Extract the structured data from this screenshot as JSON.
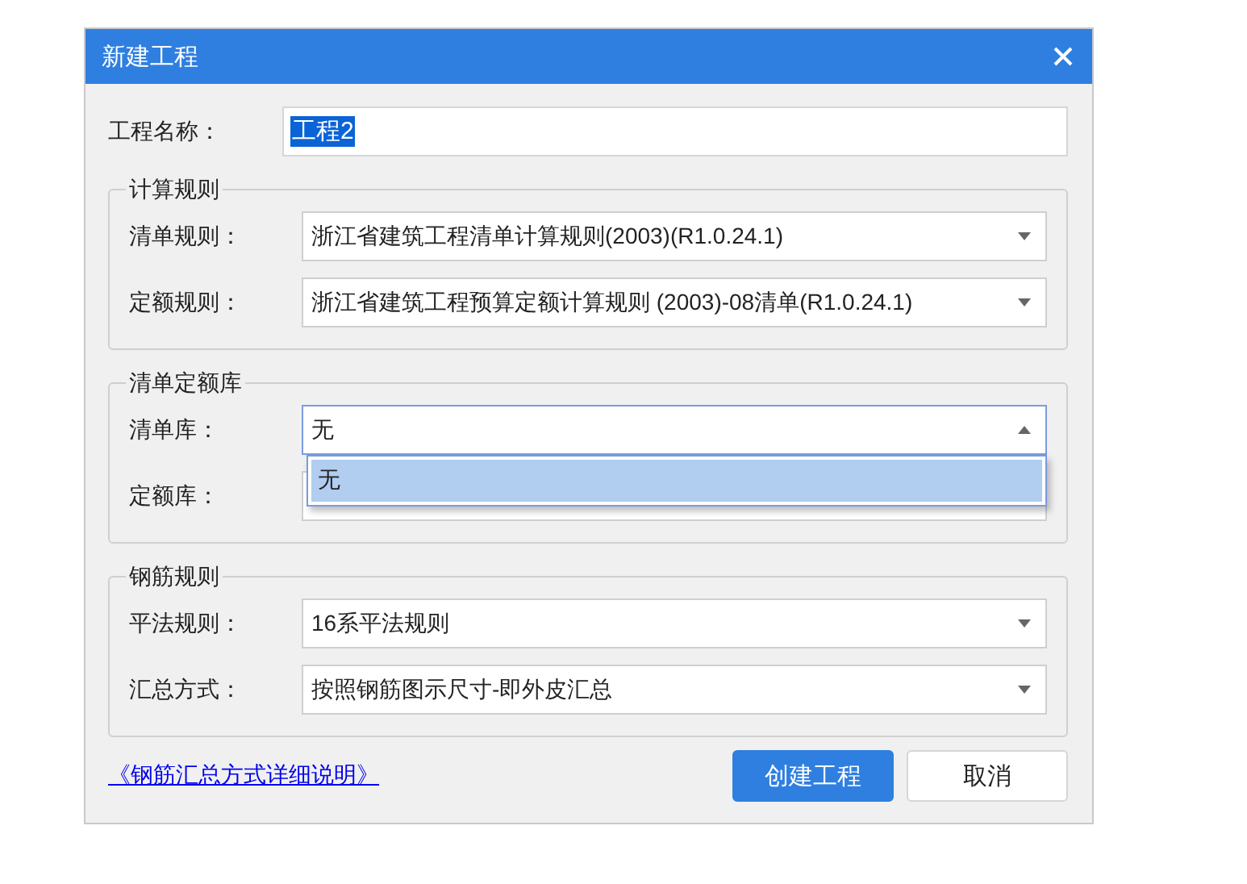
{
  "window": {
    "title": "新建工程"
  },
  "project_name": {
    "label": "工程名称：",
    "value": "工程2",
    "selected": true
  },
  "groups": [
    {
      "title": "计算规则",
      "fields": [
        {
          "label": "清单规则：",
          "value": "浙江省建筑工程清单计算规则(2003)(R1.0.24.1)",
          "expanded": false
        },
        {
          "label": "定额规则：",
          "value": "浙江省建筑工程预算定额计算规则 (2003)-08清单(R1.0.24.1)",
          "expanded": false
        }
      ]
    },
    {
      "title": "清单定额库",
      "fields": [
        {
          "label": "清单库：",
          "value": "无",
          "expanded": true,
          "options": [
            {
              "label": "无",
              "selected": true
            }
          ]
        },
        {
          "label": "定额库：",
          "expanded": false
        }
      ]
    },
    {
      "title": "钢筋规则",
      "fields": [
        {
          "label": "平法规则：",
          "value": "16系平法规则",
          "expanded": false
        },
        {
          "label": "汇总方式：",
          "value": "按照钢筋图示尺寸-即外皮汇总",
          "expanded": false
        }
      ]
    }
  ],
  "link": "《钢筋汇总方式详细说明》",
  "buttons": [
    {
      "label": "创建工程",
      "kind": "primary"
    },
    {
      "label": "取消",
      "kind": "secondary"
    }
  ]
}
